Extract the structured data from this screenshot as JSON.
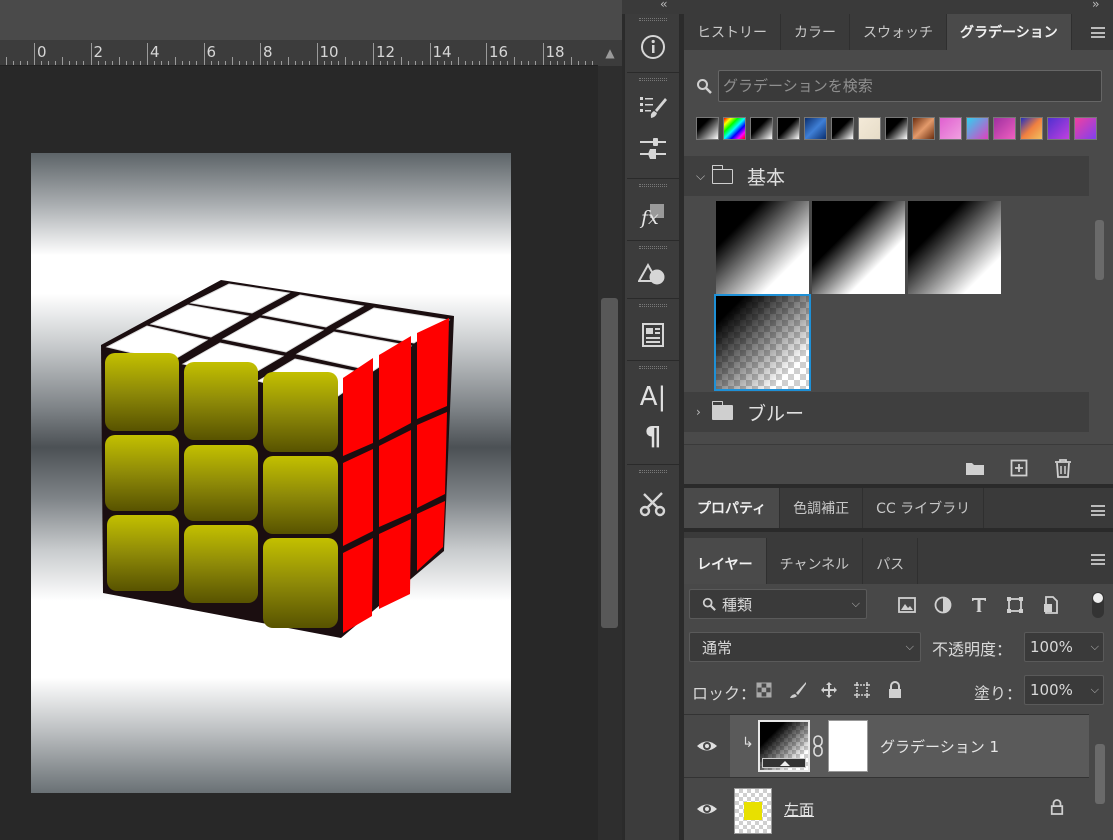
{
  "ruler": {
    "labels": [
      "0",
      "2",
      "4",
      "6",
      "8",
      "10",
      "12",
      "14",
      "16",
      "18"
    ]
  },
  "tool_strip": {
    "collapse_left": "‹‹",
    "collapse_right": "››",
    "tools": [
      {
        "name": "info-icon"
      },
      {
        "name": "brush-settings-icon"
      },
      {
        "name": "adjustments-icon"
      },
      {
        "name": "fx-icon",
        "label": "fx"
      },
      {
        "name": "shapes-icon"
      },
      {
        "name": "document-icon"
      },
      {
        "name": "character-icon",
        "label": "A|"
      },
      {
        "name": "paragraph-icon",
        "label": "¶"
      },
      {
        "name": "tool-presets-icon"
      }
    ]
  },
  "gradient_panel": {
    "tabs": [
      "ヒストリー",
      "カラー",
      "スウォッチ",
      "グラデーション"
    ],
    "active_tab": "グラデーション",
    "search_placeholder": "グラデーションを検索",
    "swatch_icons": [
      "black-white-gradient",
      "rainbow-gradient",
      "black-gradient",
      "black-gradient",
      "blue-gradient",
      "black-gradient",
      "cream-gradient",
      "black-gradient",
      "copper-gradient",
      "pink-gradient",
      "cyan-magenta-gradient",
      "violet-pink-gradient",
      "orange-blue-gradient",
      "violet-gradient",
      "pink-violet-gradient"
    ],
    "groups": [
      {
        "label": "基本",
        "expanded": true,
        "chevron": "⌵"
      },
      {
        "label": "ブルー",
        "expanded": false,
        "chevron": "›"
      }
    ],
    "footer_icons": [
      "new-group-icon",
      "new-gradient-icon",
      "trash-icon"
    ]
  },
  "properties_panel": {
    "tabs": [
      "プロパティ",
      "色調補正",
      "CC ライブラリ"
    ],
    "active_tab": "プロパティ"
  },
  "layers_panel": {
    "tabs": [
      "レイヤー",
      "チャンネル",
      "パス"
    ],
    "active_tab": "レイヤー",
    "filter_kind": "種類",
    "blend_mode": "通常",
    "opacity_label": "不透明度：",
    "opacity_value": "100%",
    "lock_label": "ロック：",
    "fill_label": "塗り：",
    "fill_value": "100%",
    "layers": [
      {
        "name": "グラデーション 1",
        "visible": true,
        "selected": true,
        "clipped": true
      },
      {
        "name": "左面",
        "visible": true,
        "selected": false,
        "locked": true
      }
    ]
  },
  "colors": {
    "cube_yellow": "#a8a800",
    "cube_red": "#ff0000",
    "cube_white": "#ffffff",
    "selection_blue": "#1e90d6"
  }
}
